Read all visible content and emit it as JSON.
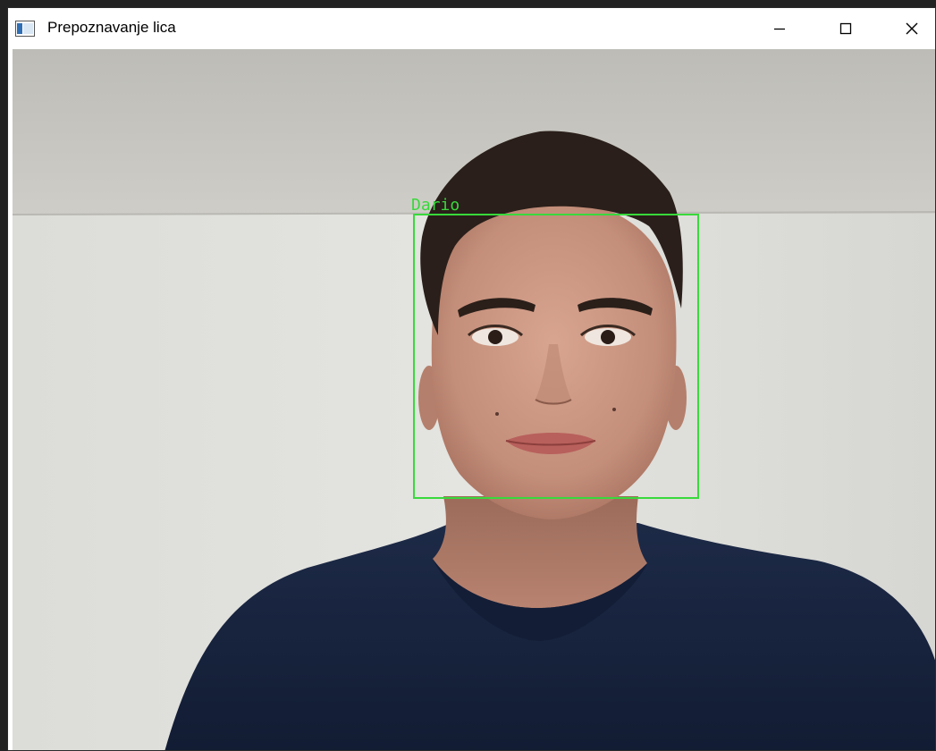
{
  "window": {
    "title": "Prepoznavanje lica",
    "controls": {
      "minimize": "minimize-icon",
      "maximize": "maximize-icon",
      "close": "close-icon"
    }
  },
  "camera_view": {
    "detections": [
      {
        "label": "Dario",
        "color": "#39d93c"
      }
    ]
  }
}
